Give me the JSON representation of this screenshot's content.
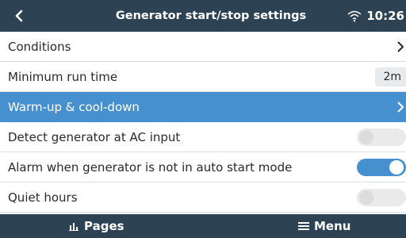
{
  "header": {
    "title": "Generator start/stop settings",
    "time": "10:26",
    "icons": {
      "back": "chevron-left-icon",
      "wifi": "wifi-icon"
    },
    "bg_color": "#2d4354"
  },
  "list": {
    "items": [
      {
        "label": "Conditions",
        "control": "chevron"
      },
      {
        "label": "Minimum run time",
        "control": "value",
        "value": "2m"
      },
      {
        "label": "Warm-up & cool-down",
        "control": "chevron",
        "selected": true
      },
      {
        "label": "Detect generator at AC input",
        "control": "toggle",
        "on": false
      },
      {
        "label": "Alarm when generator is not in auto start mode",
        "control": "toggle",
        "on": true
      },
      {
        "label": "Quiet hours",
        "control": "toggle",
        "on": false
      }
    ],
    "selected_color": "#4790d0"
  },
  "footer": {
    "pages_label": "Pages",
    "menu_label": "Menu",
    "icons": {
      "pages": "bar-chart-icon",
      "menu": "hamburger-menu-icon"
    }
  }
}
